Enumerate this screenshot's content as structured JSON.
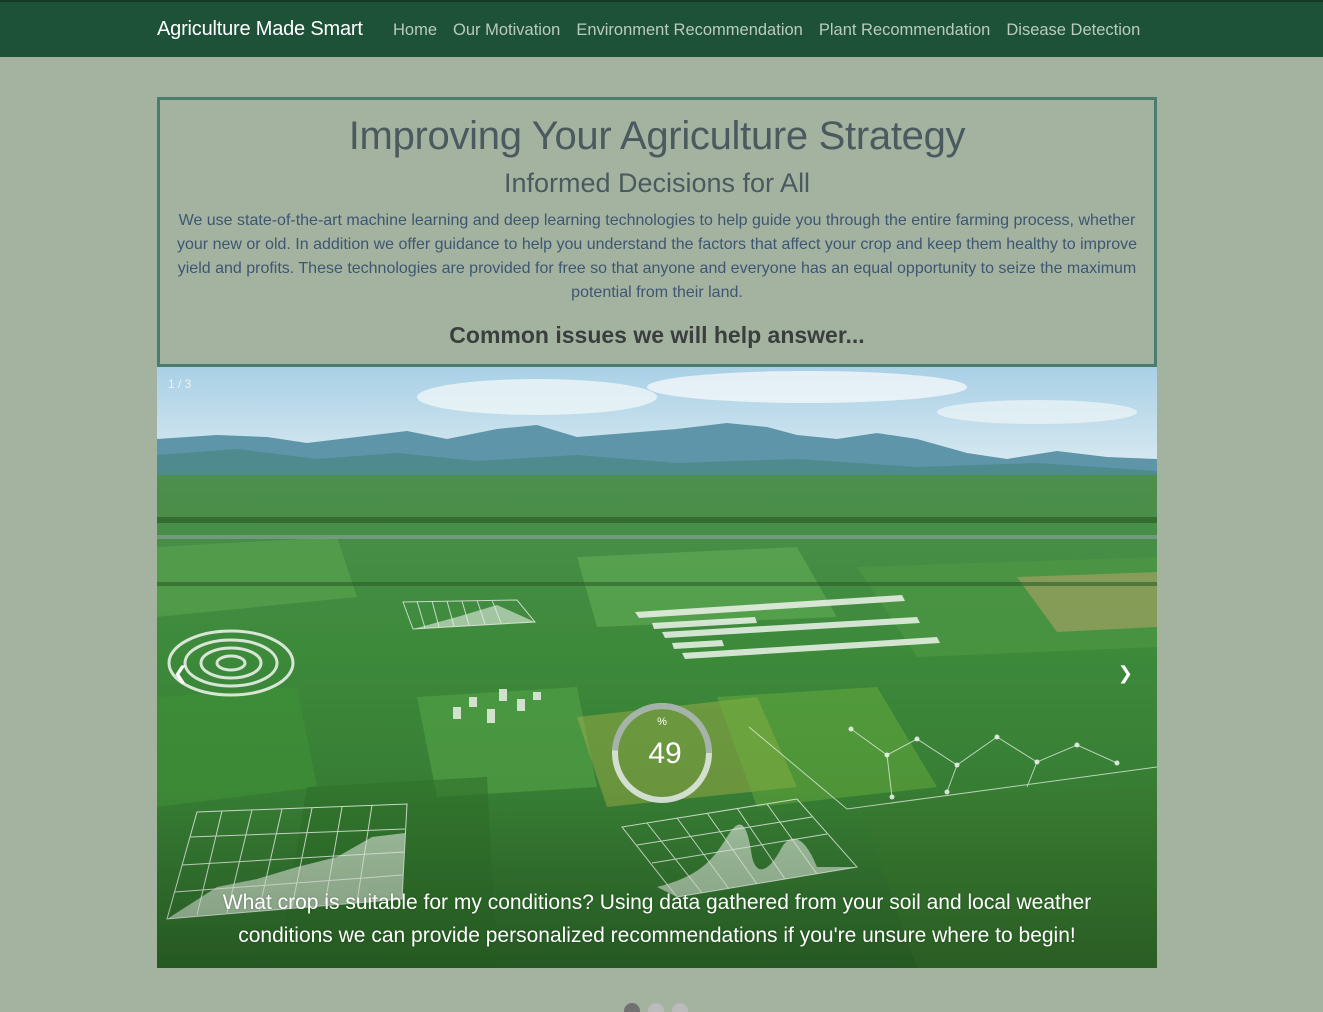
{
  "navbar": {
    "brand": "Agriculture Made Smart",
    "links": [
      {
        "label": "Home"
      },
      {
        "label": "Our Motivation"
      },
      {
        "label": "Environment Recommendation"
      },
      {
        "label": "Plant Recommendation"
      },
      {
        "label": "Disease Detection"
      }
    ]
  },
  "intro": {
    "title": "Improving Your Agriculture Strategy",
    "subtitle": "Informed Decisions for All",
    "body": "We use state-of-the-art machine learning and deep learning technologies to help guide you through the entire farming process, whether your new or old. In addition we offer guidance to help you understand the factors that affect your crop and keep them healthy to improve yield and profits. These technologies are provided for free so that anyone and everyone has an equal opportunity to seize the maximum potential from their land.",
    "common_issues": "Common issues we will help answer..."
  },
  "slideshow": {
    "counter": "1 / 3",
    "prev_icon": "❮",
    "next_icon": "❯",
    "overlay_percent": "49",
    "overlay_percent_sign": "%",
    "caption": "What crop is suitable for my conditions? Using data gathered from your soil and local weather conditions we can provide personalized recommendations if you're unsure where to begin!",
    "slide_count": 3,
    "active_slide": 1
  },
  "colors": {
    "navbar": "#1e5238",
    "background": "#a3b3a0",
    "box_border": "#4b7d6e"
  }
}
